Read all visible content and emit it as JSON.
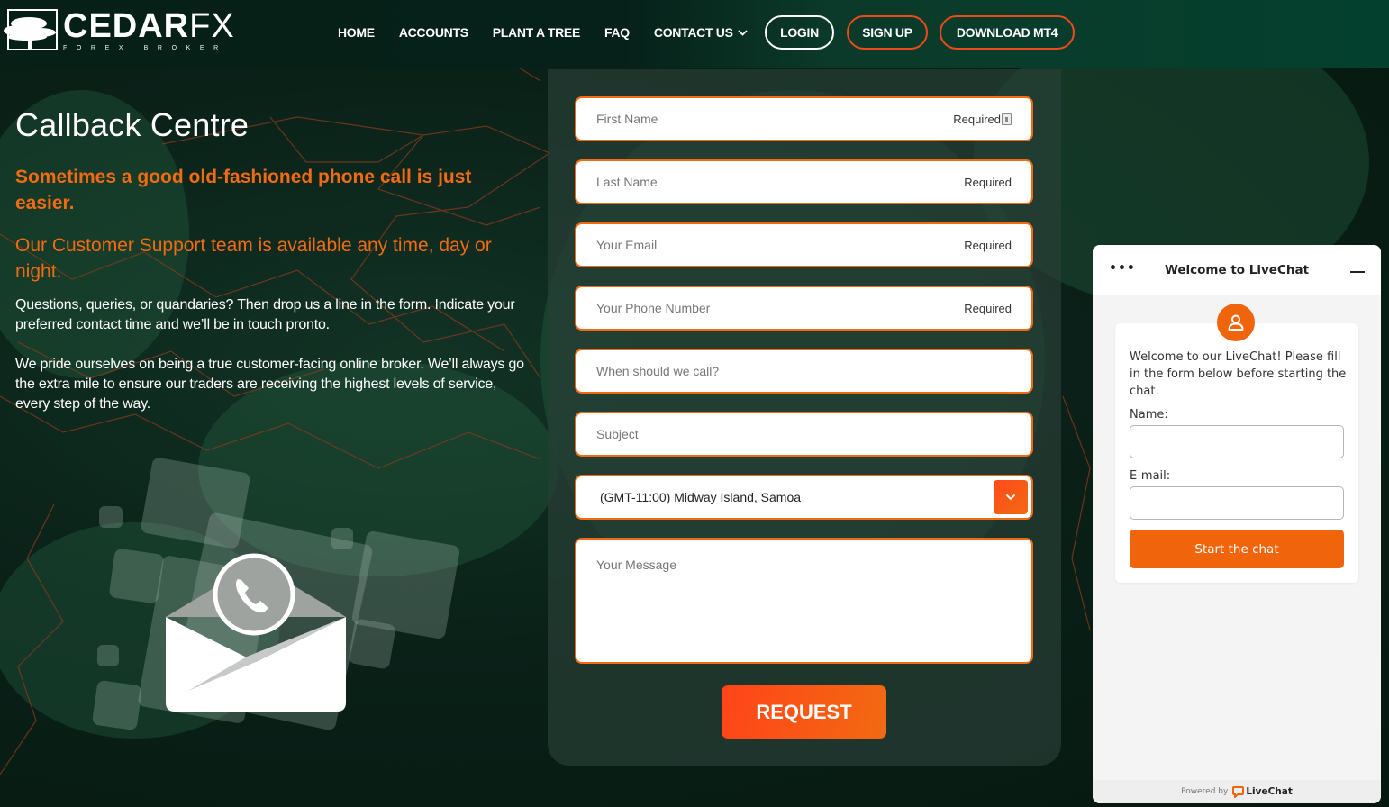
{
  "brand": {
    "name_bold": "CEDAR",
    "name_light": "FX",
    "tagline": "FOREX BROKER"
  },
  "nav": {
    "items": [
      {
        "label": "HOME"
      },
      {
        "label": "ACCOUNTS"
      },
      {
        "label": "PLANT A TREE"
      },
      {
        "label": "FAQ"
      },
      {
        "label": "CONTACT US",
        "has_dropdown": true
      }
    ],
    "login": "LOGIN",
    "signup": "SIGN UP",
    "download": "DOWNLOAD MT4"
  },
  "hero": {
    "title": "Callback Centre",
    "tagline_bold": "Sometimes a good old-fashioned phone call is just easier.",
    "tagline_regular": "Our Customer Support team is available any time, day or night.",
    "paragraph_1": "Questions, queries, or quandaries? Then drop us a line in the form. Indicate your preferred contact time and we’ll be in touch pronto.",
    "paragraph_2": "We pride ourselves on being a true customer-facing online broker. We’ll always go the extra mile to ensure our traders are receiving the highest levels of service, every step of the way."
  },
  "form": {
    "fields": [
      {
        "placeholder": "First Name",
        "required_label": "Required",
        "value": ""
      },
      {
        "placeholder": "Last Name",
        "required_label": "Required",
        "value": ""
      },
      {
        "placeholder": "Your Email",
        "required_label": "Required",
        "value": ""
      },
      {
        "placeholder": "Your Phone Number",
        "required_label": "Required",
        "value": ""
      },
      {
        "placeholder": "When should we call?",
        "value": ""
      },
      {
        "placeholder": "Subject",
        "value": ""
      }
    ],
    "timezone_selected": "(GMT-11:00) Midway Island, Samoa",
    "message_placeholder": "Your Message",
    "submit_label": "REQUEST"
  },
  "livechat": {
    "header_title": "Welcome to LiveChat",
    "welcome_message": "Welcome to our LiveChat! Please fill in the form below before starting the chat.",
    "name_label": "Name:",
    "email_label": "E-mail:",
    "name_value": "",
    "email_value": "",
    "start_label": "Start the chat",
    "powered_by": "Powered by",
    "powered_brand": "LiveChat"
  },
  "colors": {
    "accent_orange": "#f26a12",
    "button_red_orange": "#ff4419",
    "livechat_orange": "#f0640c",
    "header_green": "#04402e",
    "background_dark_green": "#0a2118"
  }
}
